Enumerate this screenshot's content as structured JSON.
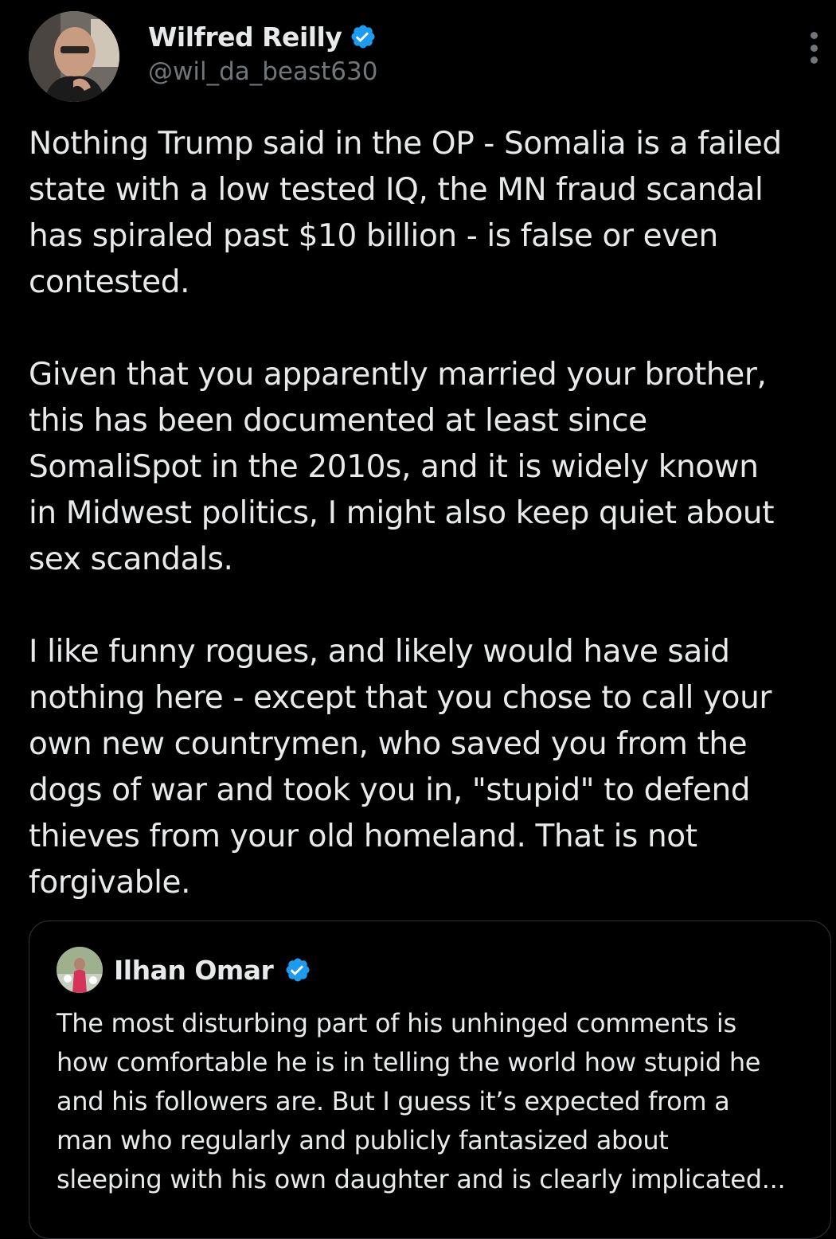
{
  "author": {
    "name": "Wilfred Reilly",
    "handle": "@wil_da_beast630",
    "verified": true
  },
  "tweet": {
    "paragraphs": [
      "Nothing Trump said in the OP - Somalia is a failed\nstate with a low tested IQ, the MN fraud scandal\nhas spiraled past $10 billion - is false or even\ncontested.",
      "Given that you apparently married your brother,\nthis has been documented at least since\nSomaliSpot in the 2010s, and it is widely known\nin Midwest politics, I might also keep quiet about\nsex scandals.",
      "I like funny rogues, and likely would have said\nnothing here - except that you chose to call your\nown new countrymen, who saved you from the\ndogs of war and took you in, \"stupid\" to defend\nthieves from your old homeland. That is not\nforgivable."
    ]
  },
  "quoted_tweet": {
    "author_name": "Ilhan Omar",
    "verified": true,
    "text": "The most disturbing part of his unhinged comments is\nhow comfortable he is in telling the world how stupid he\nand his followers are. But I guess it’s expected from a\nman who regularly and publicly fantasized about\nsleeping with his own daughter and is clearly implicated..."
  },
  "icons": {
    "verified": "verified-badge-icon",
    "more": "more-options-icon"
  },
  "colors": {
    "background": "#000000",
    "text": "#e7e9ea",
    "secondary": "#71767b",
    "verified": "#1d9bf0",
    "border": "#2f3336"
  }
}
